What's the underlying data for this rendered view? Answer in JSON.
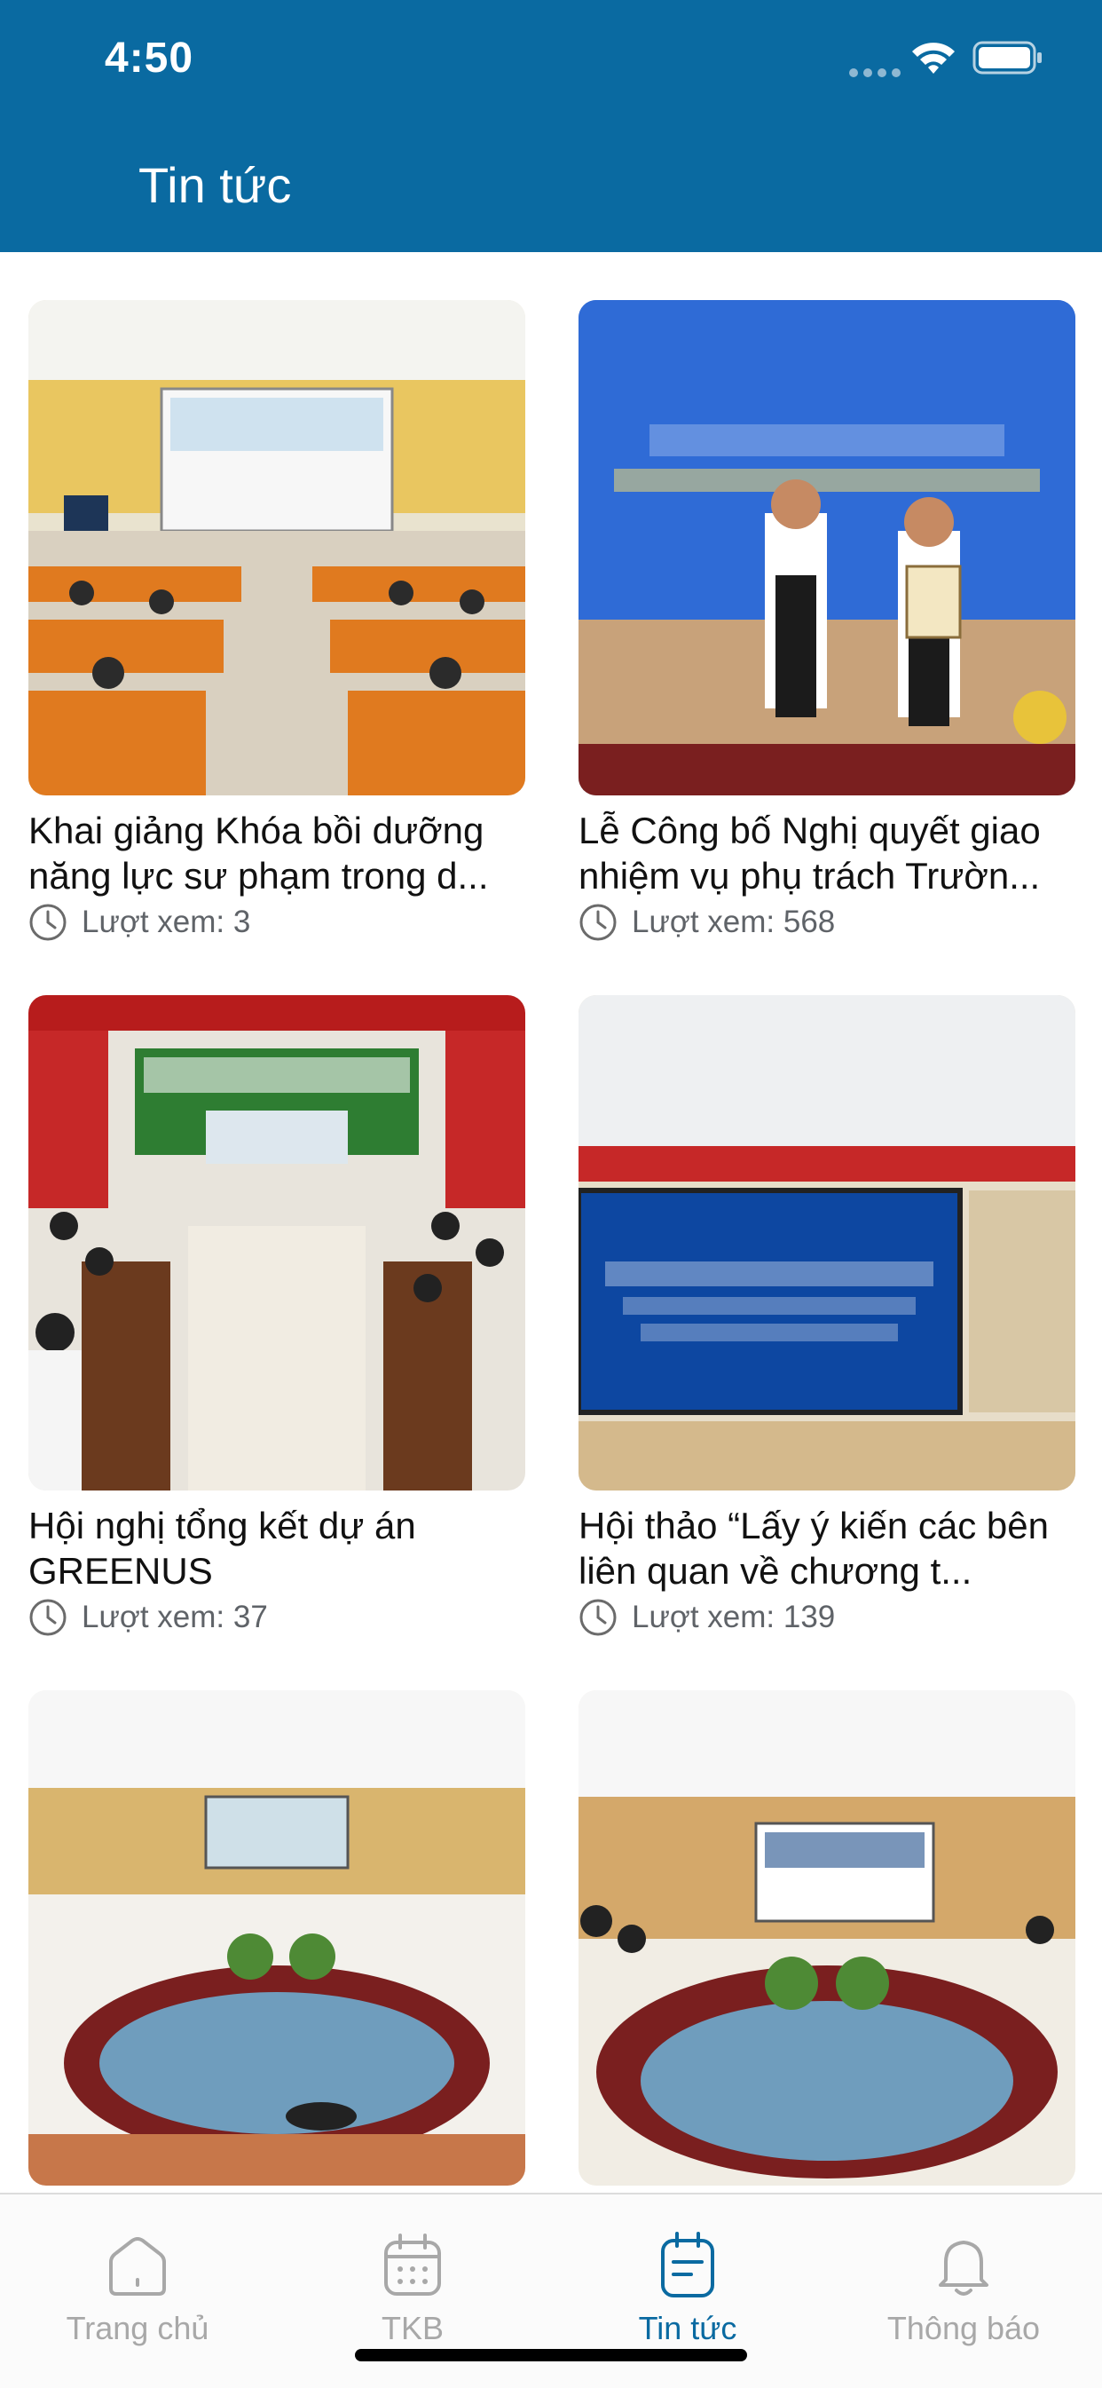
{
  "status_bar": {
    "time": "4:50"
  },
  "header": {
    "title": "Tin tức"
  },
  "news": [
    {
      "title": "Khai giảng Khóa bồi dưỡng năng lực sư phạm trong d...",
      "views_label": "Lượt xem: 3",
      "image": "Classroom lecture hall with audience and projector screen"
    },
    {
      "title": "Lễ Công bố Nghị quyết giao nhiệm vụ phụ trách Trườn...",
      "views_label": "Lượt xem: 568",
      "image": "Two officials on stage handing over a certificate and flowers"
    },
    {
      "title": "Hội nghị tổng kết dự án GREENUS",
      "views_label": "Lượt xem: 37",
      "image": "Conference room with red curtains and GREENUS banner"
    },
    {
      "title": "Hội thảo “Lấy ý kiến các bên liên quan về chương t...",
      "views_label": "Lượt xem: 139",
      "image": "Blue presentation screen in a meeting hall"
    },
    {
      "title": "",
      "views_label": "",
      "image": "Oval meeting room with plants in the center"
    },
    {
      "title": "",
      "views_label": "",
      "image": "Meeting room welcoming Ghent University, Belgium"
    }
  ],
  "tabs": [
    {
      "label": "Trang chủ",
      "icon": "home-icon",
      "active": false
    },
    {
      "label": "TKB",
      "icon": "calendar-icon",
      "active": false
    },
    {
      "label": "Tin tức",
      "icon": "news-icon",
      "active": true
    },
    {
      "label": "Thông báo",
      "icon": "bell-icon",
      "active": false
    }
  ],
  "colors": {
    "header": "#0a6aa1",
    "accent": "#0a6aa1",
    "tab_inactive": "#a8a8a8"
  }
}
